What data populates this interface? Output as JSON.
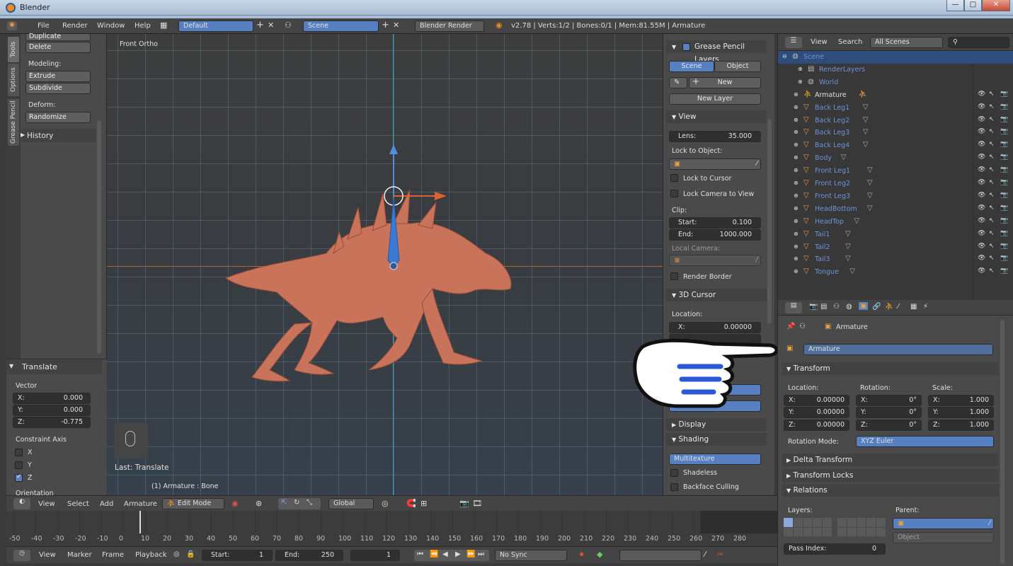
{
  "window": {
    "title": "Blender",
    "min": "—",
    "max": "□",
    "close": "✕"
  },
  "infobar": {
    "menus": [
      "File",
      "Render",
      "Window",
      "Help"
    ],
    "layout": "Default",
    "scene": "Scene",
    "engine": "Blender Render",
    "stats": "v2.78 | Verts:1/2 | Bones:0/1 | Mem:81.55M | Armature"
  },
  "toolshelf": {
    "tabs": [
      "Tools",
      "Options",
      "Grease Pencil"
    ],
    "duplicate": "Duplicate",
    "delete": "Delete",
    "modeling_label": "Modeling:",
    "extrude": "Extrude",
    "subdivide": "Subdivide",
    "deform_label": "Deform:",
    "randomize": "Randomize",
    "history": "History"
  },
  "operator": {
    "title": "Translate",
    "vector_label": "Vector",
    "x_label": "X:",
    "x": "0.000",
    "y_label": "Y:",
    "y": "0.000",
    "z_label": "Z:",
    "z": "-0.775",
    "constraint_label": "Constraint Axis",
    "axes": [
      "X",
      "Y",
      "Z"
    ],
    "axis_checked": [
      false,
      false,
      true
    ],
    "orientation_label": "Orientation"
  },
  "viewport": {
    "view_name": "Front Ortho",
    "last_op": "Last: Translate",
    "status": "(1) Armature : Bone"
  },
  "npanel": {
    "gp_title": "Grease Pencil Layers",
    "gp_scene": "Scene",
    "gp_object": "Object",
    "gp_new": "New",
    "gp_new_layer": "New Layer",
    "view_title": "View",
    "lens_label": "Lens:",
    "lens": "35.000",
    "lock_obj_label": "Lock to Object:",
    "lock_cursor": "Lock to Cursor",
    "lock_camera": "Lock Camera to View",
    "clip_label": "Clip:",
    "start_label": "Start:",
    "start": "0.100",
    "end_label": "End:",
    "end": "1000.000",
    "local_camera": "Local Camera:",
    "render_border": "Render Border",
    "cursor_title": "3D Cursor",
    "location_label": "Location:",
    "cx_label": "X:",
    "cx": "0.00000",
    "display_title": "Display",
    "shading_title": "Shading",
    "shading_mode": "Multitexture",
    "shadeless": "Shadeless",
    "backface": "Backface Culling"
  },
  "outliner": {
    "view": "View",
    "search": "Search",
    "filter": "All Scenes",
    "items": [
      {
        "name": "Scene",
        "type": "scene"
      },
      {
        "name": "RenderLayers",
        "type": "renderlayers"
      },
      {
        "name": "World",
        "type": "world"
      },
      {
        "name": "Armature",
        "type": "armature"
      },
      {
        "name": "Back Leg1",
        "type": "mesh"
      },
      {
        "name": "Back Leg2",
        "type": "mesh"
      },
      {
        "name": "Back Leg3",
        "type": "mesh"
      },
      {
        "name": "Back Leg4",
        "type": "mesh"
      },
      {
        "name": "Body",
        "type": "mesh"
      },
      {
        "name": "Front Leg1",
        "type": "mesh"
      },
      {
        "name": "Front Leg2",
        "type": "mesh"
      },
      {
        "name": "Front Leg3",
        "type": "mesh"
      },
      {
        "name": "HeadBottom",
        "type": "mesh"
      },
      {
        "name": "HeadTop",
        "type": "mesh"
      },
      {
        "name": "Tail1",
        "type": "mesh"
      },
      {
        "name": "Tail2",
        "type": "mesh"
      },
      {
        "name": "Tail3",
        "type": "mesh"
      },
      {
        "name": "Tongue",
        "type": "mesh"
      }
    ]
  },
  "properties": {
    "breadcrumb": "Armature",
    "object_name": "Armature",
    "transform": "Transform",
    "location": "Location:",
    "rotation": "Rotation:",
    "scale": "Scale:",
    "lx": "0.00000",
    "ly": "0.00000",
    "lz": "0.00000",
    "rx": "0°",
    "ry": "0°",
    "rz": "0°",
    "sx": "1.000",
    "sy": "1.000",
    "sz": "1.000",
    "ax_x": "X:",
    "ax_y": "Y:",
    "ax_z": "Z:",
    "rotation_mode_label": "Rotation Mode:",
    "rotation_mode": "XYZ Euler",
    "delta": "Delta Transform",
    "locks": "Transform Locks",
    "relations": "Relations",
    "layers": "Layers:",
    "parent": "Parent:",
    "parent_type": "Object",
    "pass_index_label": "Pass Index:",
    "pass_index": "0"
  },
  "vheader": {
    "view": "View",
    "select": "Select",
    "add": "Add",
    "armature": "Armature",
    "mode": "Edit Mode",
    "orientation": "Global"
  },
  "timeline": {
    "ticks": [
      "-50",
      "-40",
      "-30",
      "-20",
      "-10",
      "0",
      "10",
      "20",
      "30",
      "40",
      "50",
      "60",
      "70",
      "80",
      "90",
      "100",
      "110",
      "120",
      "130",
      "140",
      "150",
      "160",
      "170",
      "180",
      "190",
      "200",
      "210",
      "220",
      "230",
      "240",
      "250",
      "260",
      "270",
      "280"
    ],
    "view": "View",
    "marker": "Marker",
    "frame": "Frame",
    "playback": "Playback",
    "start_label": "Start:",
    "start": "1",
    "end_label": "End:",
    "end": "250",
    "current": "1",
    "sync": "No Sync"
  }
}
